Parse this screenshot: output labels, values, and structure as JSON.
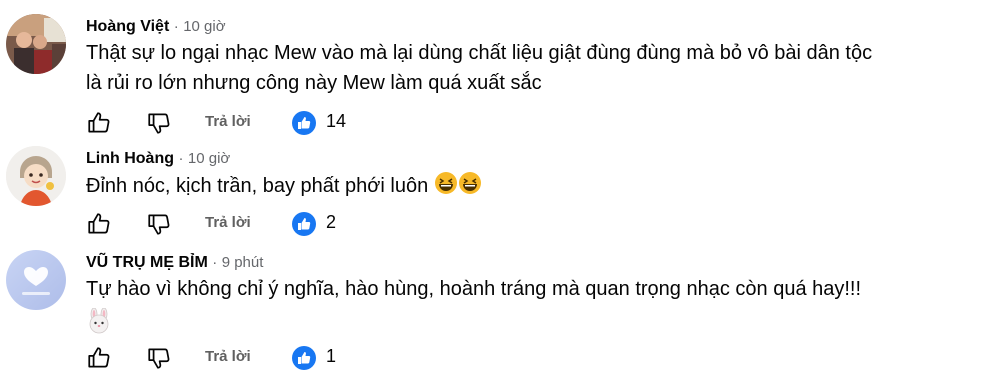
{
  "comments": [
    {
      "author": "Hoàng Việt",
      "time": "10 giờ",
      "text_lines": [
        "Thật sự lo ngại nhạc Mew vào mà lại dùng chất liệu giật đùng đùng mà bỏ vô bài dân tộc",
        "là rủi ro lớn nhưng công này Mew làm quá xuất sắc"
      ],
      "reply_label": "Trả lời",
      "likes": "14"
    },
    {
      "author": "Linh Hoàng",
      "time": "10 giờ",
      "text_lines": [
        "Đỉnh nóc, kịch trần, bay phất phới luôn"
      ],
      "emojis": [
        "grinning-squint-emoji",
        "grinning-squint-emoji"
      ],
      "reply_label": "Trả lời",
      "likes": "2"
    },
    {
      "author": "VŨ TRỤ MẸ BỈM",
      "time": "9 phút",
      "text_lines": [
        "Tự hào vì không chỉ ý nghĩa, hào hùng, hoành tráng mà quan trọng nhạc còn quá hay!!!"
      ],
      "emojis": [
        "rabbit-emoji"
      ],
      "reply_label": "Trả lời",
      "likes": "1"
    }
  ],
  "separator": "·",
  "colors": {
    "like_blue": "#1877f2",
    "muted": "#65676b",
    "text": "#050505"
  }
}
